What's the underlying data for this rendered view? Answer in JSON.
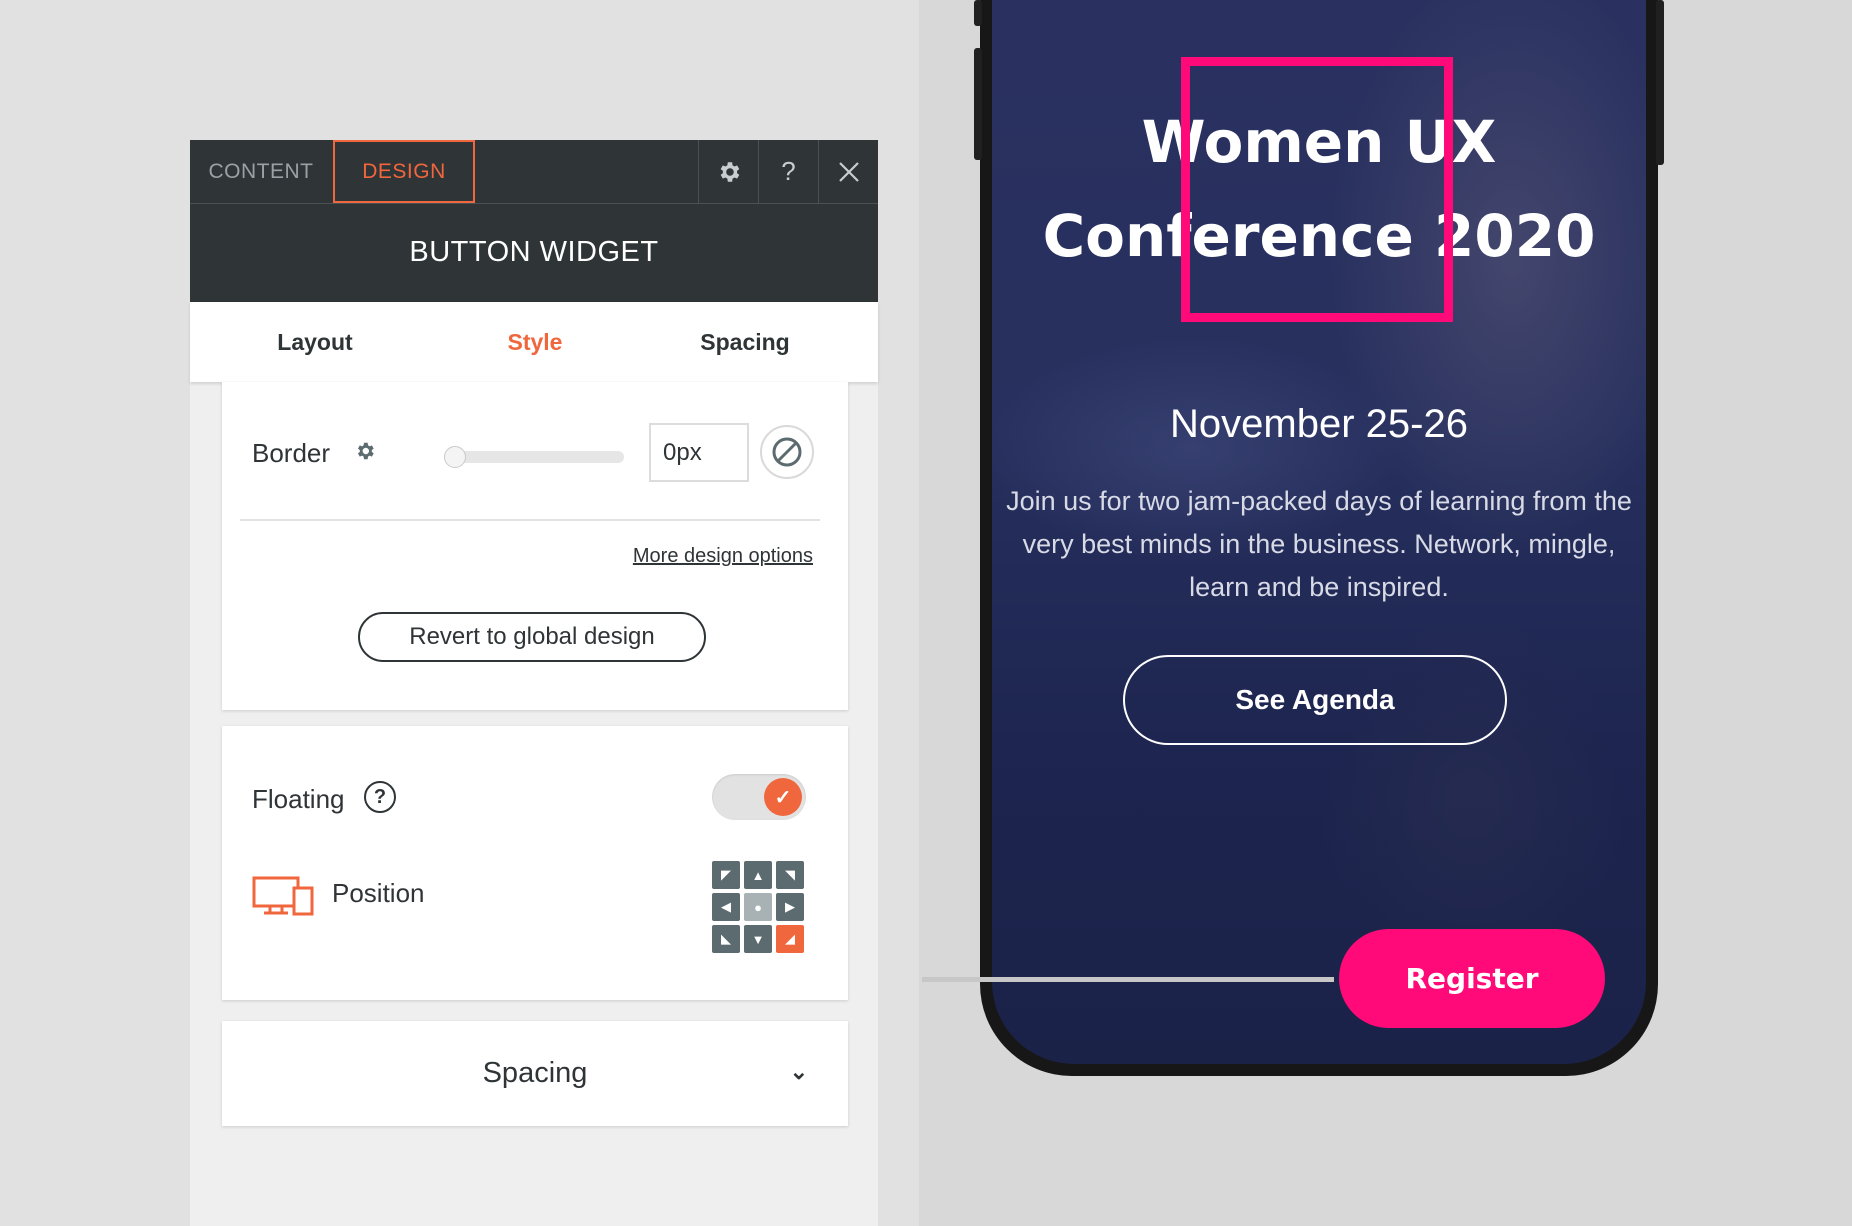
{
  "editor": {
    "tabs": {
      "content": "CONTENT",
      "design": "DESIGN"
    },
    "tools": {
      "settings_icon": "gear-icon",
      "help": "?",
      "close": "✕"
    },
    "title": "BUTTON WIDGET",
    "subtabs": {
      "layout": "Layout",
      "style": "Style",
      "spacing": "Spacing"
    },
    "border": {
      "label": "Border",
      "value": "0px",
      "slider_level": 0
    },
    "more_options": "More design options",
    "revert": "Revert to global design",
    "floating": {
      "label": "Floating",
      "help": "?",
      "enabled": true
    },
    "position": {
      "label": "Position",
      "selected": "bottom-right"
    },
    "spacing_section": "Spacing"
  },
  "phone": {
    "title_line1": "Women UX",
    "title_line2": "Conference 2020",
    "date": "November 25-26",
    "description": "Join us for two jam-packed days of learning from the very best minds in the business. Network, mingle, learn and be inspired.",
    "agenda_button": "See Agenda",
    "register_button": "Register"
  },
  "colors": {
    "accent": "#f0663d",
    "dark": "#2f3437",
    "brand_pink": "#ff0a78"
  }
}
